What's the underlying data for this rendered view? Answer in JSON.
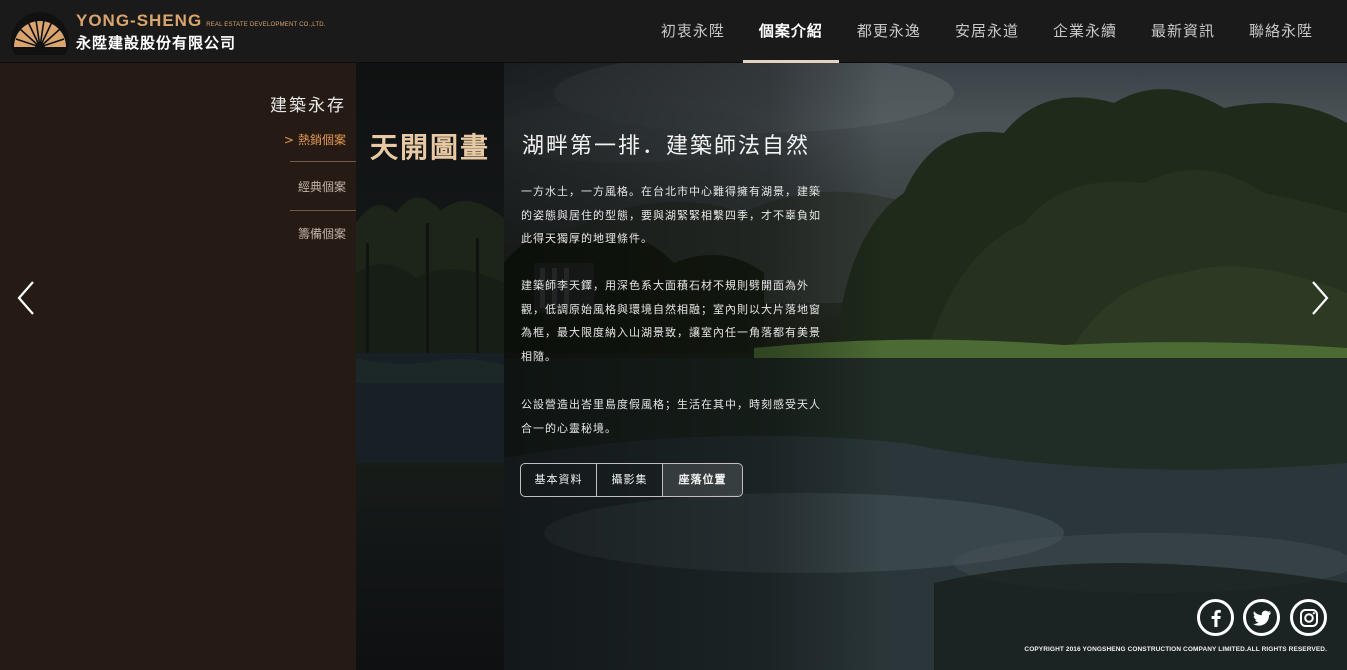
{
  "header": {
    "logo_en": "YONG-SHENG",
    "logo_en_sub": "REAL ESTATE DEVELOPMENT CO.,LTD.",
    "logo_zh": "永陞建設股份有限公司",
    "nav": [
      "初衷永陞",
      "個案介紹",
      "都更永逸",
      "安居永道",
      "企業永續",
      "最新資訊",
      "聯絡永陞"
    ],
    "active_nav": "個案介紹"
  },
  "sidebar": {
    "title": "建築永存",
    "items": [
      {
        "label": "熱銷個案",
        "arrow": ">",
        "active": true
      },
      {
        "label": "經典個案",
        "active": false
      },
      {
        "label": "籌備個案",
        "active": false
      }
    ]
  },
  "project": {
    "name": "天開圖畫",
    "headline": "湖畔第一排．建築師法自然",
    "paragraphs": [
      "一方水土，一方風格。在台北市中心難得擁有湖景，建築的姿態與居住的型態，要與湖緊緊相繫四季，才不辜負如此得天獨厚的地理條件。",
      "建築師李天鐸，用深色系大面積石材不規則劈開面為外觀，低調原始風格與環境自然相融；室內則以大片落地窗為框，最大限度納入山湖景致，讓室內任一角落都有美景相隨。",
      "公設營造出峇里島度假風格；生活在其中，時刻感受天人合一的心靈秘境。"
    ],
    "tabs": [
      "基本資料",
      "攝影集",
      "座落位置"
    ],
    "active_tab": "座落位置"
  },
  "social": [
    "facebook-icon",
    "twitter-icon",
    "instagram-icon"
  ],
  "footer": {
    "copyright": "COPYRIGHT 2016 YONGSHENG CONSTRUCTION COMPANY LIMITED.ALL RIGHTS RESERVED."
  },
  "colors": {
    "brand_gold": "#d9a46d",
    "sidebar_bg": "#251a14",
    "active_orange": "#e59a53",
    "project_name": "#e7c9a4"
  }
}
